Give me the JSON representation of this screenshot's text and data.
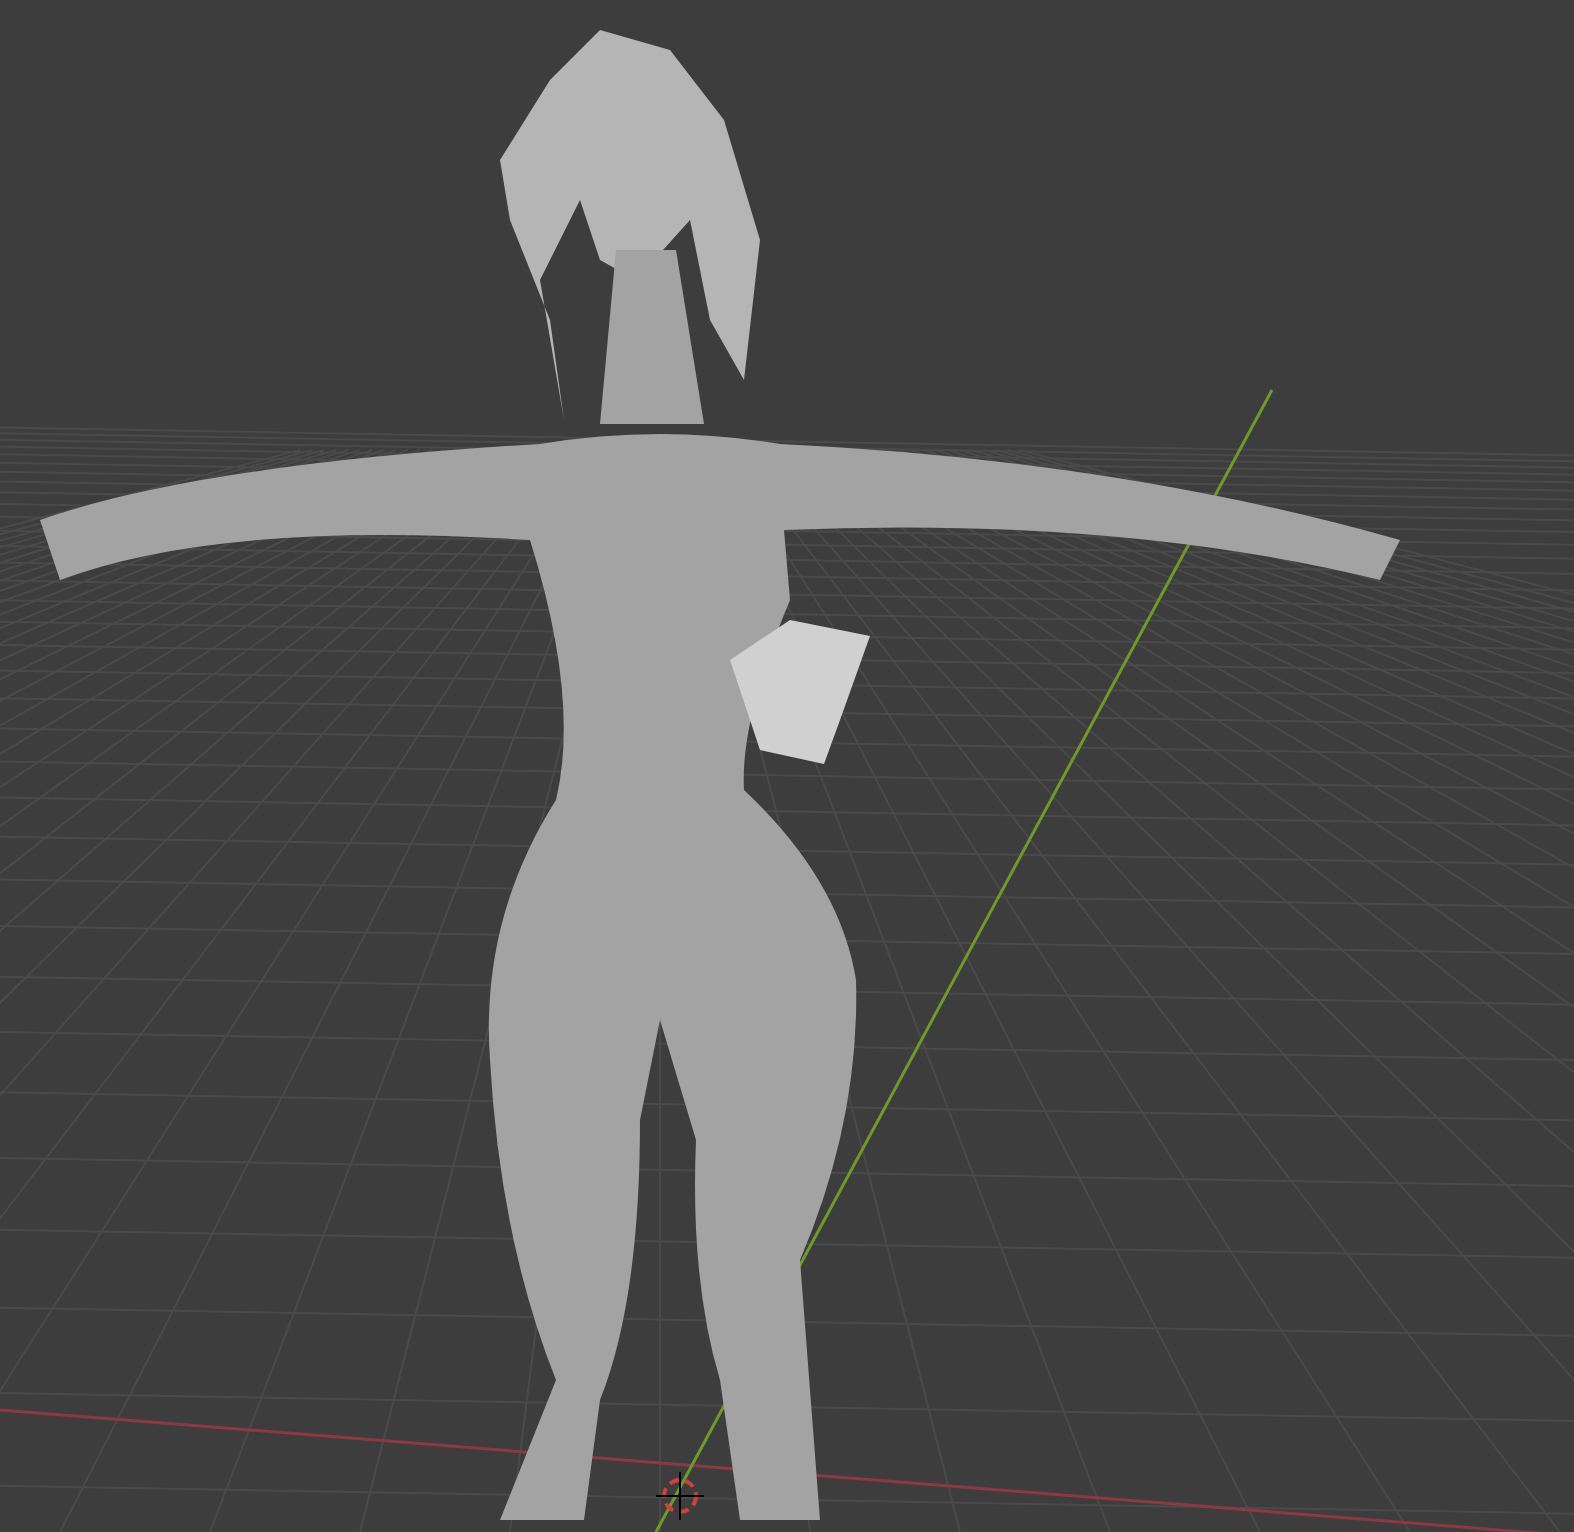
{
  "viewport": {
    "axes": [
      {
        "kind": "x"
      },
      {
        "kind": "y"
      }
    ]
  }
}
